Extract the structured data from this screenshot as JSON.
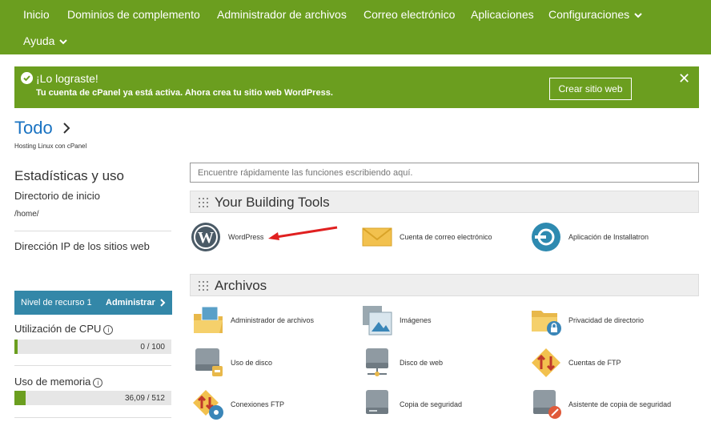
{
  "nav": {
    "items": [
      "Inicio",
      "Dominios de complemento",
      "Administrador de archivos",
      "Correo electrónico",
      "Aplicaciones",
      "Configuraciones"
    ],
    "help": "Ayuda"
  },
  "banner": {
    "title": "¡Lo lograste!",
    "message": "Tu cuenta de cPanel ya está activa. Ahora crea tu sitio web WordPress.",
    "button": "Crear sitio web",
    "close": "✕"
  },
  "breadcrumb": {
    "title": "Todo",
    "subtitle": "Hosting Linux con cPanel"
  },
  "sidebar": {
    "heading": "Estadísticas y uso",
    "home_label": "Directorio de inicio",
    "home_value": "/home/",
    "ip_label": "Dirección IP de los sitios web",
    "resource_level": "Nivel de recurso 1",
    "manage": "Administrar",
    "cpu_label": "Utilización de CPU",
    "cpu_value": "0 / 100",
    "cpu_fraction": 0.02,
    "mem_label": "Uso de memoria",
    "mem_value": "36,09 / 512",
    "mem_fraction": 0.07,
    "info_glyph": "i"
  },
  "search": {
    "placeholder": "Encuentre rápidamente las funciones escribiendo aquí."
  },
  "sections": {
    "building": {
      "title": "Your Building Tools",
      "tools": [
        "WordPress",
        "Cuenta de correo electrónico",
        "Aplicación de Installatron"
      ]
    },
    "files": {
      "title": "Archivos",
      "tools": [
        "Administrador de archivos",
        "Imágenes",
        "Privacidad de directorio",
        "Uso de disco",
        "Disco de web",
        "Cuentas de FTP",
        "Conexiones FTP",
        "Copia de seguridad",
        "Asistente de copia de seguridad"
      ]
    }
  },
  "colors": {
    "brand_green": "#6b9e1f",
    "resource_blue": "#3387a8",
    "link_blue": "#1a73c2",
    "arrow_red": "#e02020"
  },
  "icons": [
    "check-circle-icon",
    "close-icon",
    "chevron-down-icon",
    "chevron-right-icon",
    "info-icon",
    "grip-icon",
    "wordpress-icon",
    "envelope-icon",
    "installatron-icon",
    "folder-image-icon",
    "images-icon",
    "folder-lock-icon",
    "disk-icon",
    "ftp-icon",
    "backup-icon",
    "annotation-arrow-icon"
  ]
}
